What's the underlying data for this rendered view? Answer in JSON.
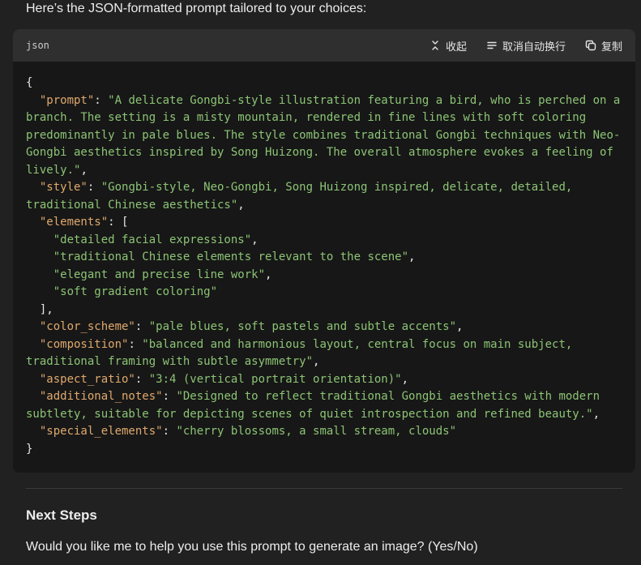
{
  "intro_text": "Here’s the JSON-formatted prompt tailored to your choices:",
  "code_block": {
    "language": "json",
    "actions": {
      "collapse": "收起",
      "toggle_wrap": "取消自动换行",
      "copy": "复制"
    },
    "lines": [
      [
        {
          "t": "p",
          "v": "{"
        }
      ],
      [
        {
          "t": "p",
          "v": "  "
        },
        {
          "t": "k",
          "v": "\"prompt\""
        },
        {
          "t": "p",
          "v": ": "
        },
        {
          "t": "s",
          "v": "\"A delicate Gongbi-style illustration featuring a bird, who is perched on a branch. The setting is a misty mountain, rendered in fine lines with soft coloring predominantly in pale blues. The style combines traditional Gongbi techniques with Neo-Gongbi aesthetics inspired by Song Huizong. The overall atmosphere evokes a feeling of lively.\""
        },
        {
          "t": "p",
          "v": ","
        }
      ],
      [
        {
          "t": "p",
          "v": "  "
        },
        {
          "t": "k",
          "v": "\"style\""
        },
        {
          "t": "p",
          "v": ": "
        },
        {
          "t": "s",
          "v": "\"Gongbi-style, Neo-Gongbi, Song Huizong inspired, delicate, detailed, traditional Chinese aesthetics\""
        },
        {
          "t": "p",
          "v": ","
        }
      ],
      [
        {
          "t": "p",
          "v": "  "
        },
        {
          "t": "k",
          "v": "\"elements\""
        },
        {
          "t": "p",
          "v": ": ["
        }
      ],
      [
        {
          "t": "p",
          "v": "    "
        },
        {
          "t": "s",
          "v": "\"detailed facial expressions\""
        },
        {
          "t": "p",
          "v": ","
        }
      ],
      [
        {
          "t": "p",
          "v": "    "
        },
        {
          "t": "s",
          "v": "\"traditional Chinese elements relevant to the scene\""
        },
        {
          "t": "p",
          "v": ","
        }
      ],
      [
        {
          "t": "p",
          "v": "    "
        },
        {
          "t": "s",
          "v": "\"elegant and precise line work\""
        },
        {
          "t": "p",
          "v": ","
        }
      ],
      [
        {
          "t": "p",
          "v": "    "
        },
        {
          "t": "s",
          "v": "\"soft gradient coloring\""
        }
      ],
      [
        {
          "t": "p",
          "v": "  ],"
        }
      ],
      [
        {
          "t": "p",
          "v": "  "
        },
        {
          "t": "k",
          "v": "\"color_scheme\""
        },
        {
          "t": "p",
          "v": ": "
        },
        {
          "t": "s",
          "v": "\"pale blues, soft pastels and subtle accents\""
        },
        {
          "t": "p",
          "v": ","
        }
      ],
      [
        {
          "t": "p",
          "v": "  "
        },
        {
          "t": "k",
          "v": "\"composition\""
        },
        {
          "t": "p",
          "v": ": "
        },
        {
          "t": "s",
          "v": "\"balanced and harmonious layout, central focus on main subject, traditional framing with subtle asymmetry\""
        },
        {
          "t": "p",
          "v": ","
        }
      ],
      [
        {
          "t": "p",
          "v": "  "
        },
        {
          "t": "k",
          "v": "\"aspect_ratio\""
        },
        {
          "t": "p",
          "v": ": "
        },
        {
          "t": "s",
          "v": "\"3:4 (vertical portrait orientation)\""
        },
        {
          "t": "p",
          "v": ","
        }
      ],
      [
        {
          "t": "p",
          "v": "  "
        },
        {
          "t": "k",
          "v": "\"additional_notes\""
        },
        {
          "t": "p",
          "v": ": "
        },
        {
          "t": "s",
          "v": "\"Designed to reflect traditional Gongbi aesthetics with modern subtlety, suitable for depicting scenes of quiet introspection and refined beauty.\""
        },
        {
          "t": "p",
          "v": ","
        }
      ],
      [
        {
          "t": "p",
          "v": "  "
        },
        {
          "t": "k",
          "v": "\"special_elements\""
        },
        {
          "t": "p",
          "v": ": "
        },
        {
          "t": "s",
          "v": "\"cherry blossoms, a small stream, clouds\""
        }
      ],
      [
        {
          "t": "p",
          "v": "}"
        }
      ]
    ]
  },
  "next_steps": {
    "heading": "Next Steps",
    "question": "Would you like me to help you use this prompt to generate an image? (Yes/No)"
  },
  "icons": {
    "collapse": "collapse-icon",
    "wrap": "wrap-lines-icon",
    "copy": "copy-icon"
  },
  "colors": {
    "background": "#212121",
    "code_background": "#171717",
    "code_header": "#2f2f2f",
    "json_key": "#e0a96d",
    "json_string": "#8cc475"
  }
}
